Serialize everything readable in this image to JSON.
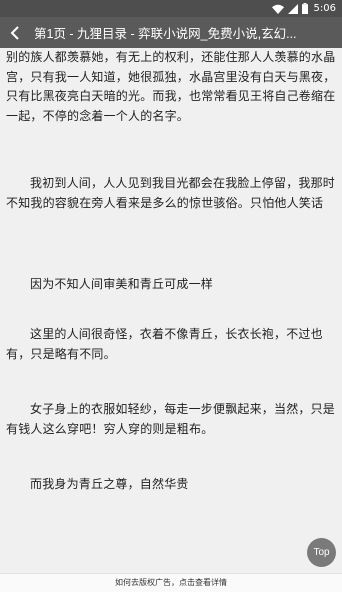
{
  "status_bar": {
    "time": "5:06",
    "icons": [
      "wifi-icon",
      "signal-icon",
      "battery-icon"
    ]
  },
  "app_bar": {
    "title": "第1页 - 九狸目录 - 弈联小说网_免费小说,玄幻..."
  },
  "content": {
    "paragraphs": [
      "别的族人都羡慕她，有无上的权利，还能住那人人羡慕的水晶宫，只有我一人知道，她很孤独，水晶宫里没有白天与黑夜，只有比黑夜亮白天暗的光。而我，也常常看见王将自己卷缩在一起，不停的念着一个人的名字。",
      "我初到人间，人人见到我目光都会在我脸上停留，我那时不知我的容貌在旁人看来是多么的惊世骇俗。只怕他人笑话",
      "因为不知人间审美和青丘可成一样",
      "这里的人间很奇怪，衣着不像青丘，长衣长袍，不过也有，只是略有不同。",
      "女子身上的衣服如轻纱，每走一步便飘起来，当然，只是有钱人这么穿吧！穷人穿的则是粗布。",
      "而我身为青丘之尊，自然华贵"
    ]
  },
  "top_button": {
    "label": "Top"
  },
  "footer": {
    "banner_text": "如何去版权广告，点击查看详情"
  },
  "colors": {
    "status_bar": "#4e4e4e",
    "app_bar": "#5a5a5a",
    "page_background": "#f0f0f0",
    "top_button": "#7a7a7a"
  }
}
